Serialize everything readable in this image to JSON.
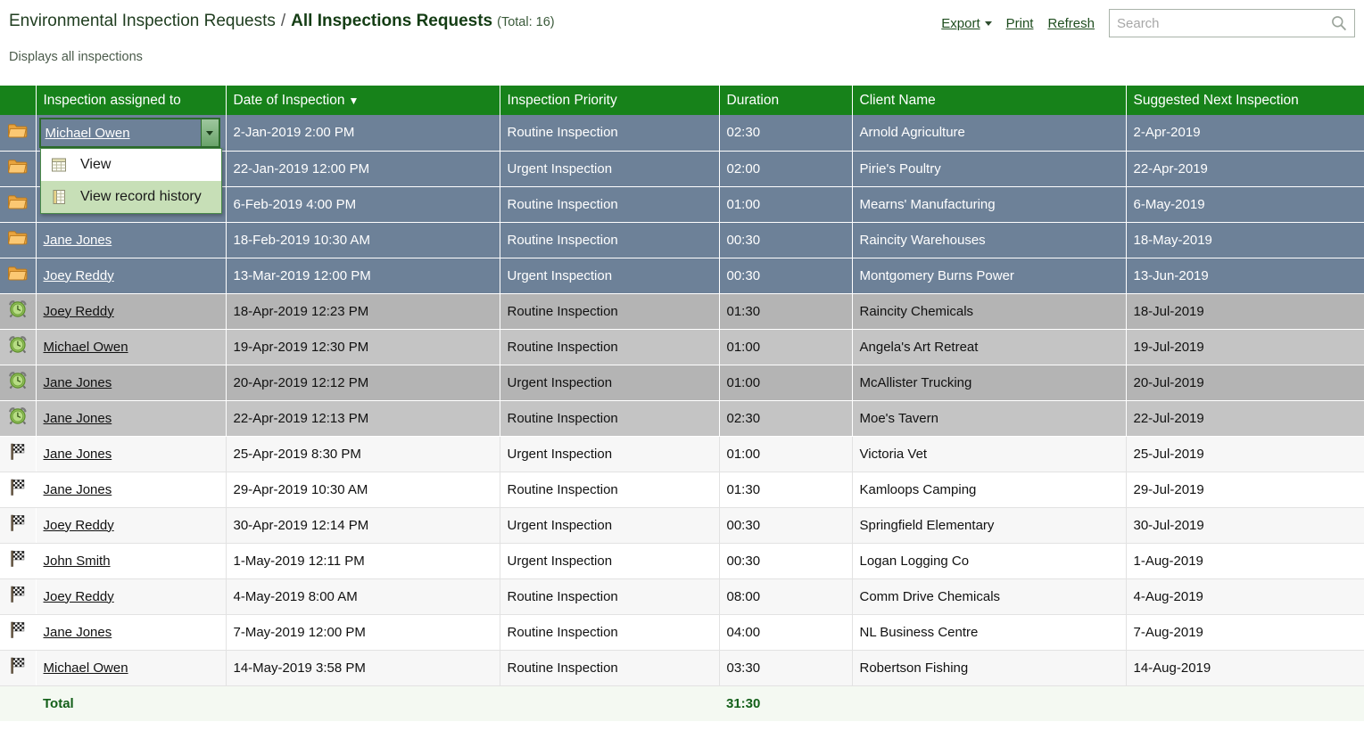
{
  "breadcrumb": {
    "parent": "Environmental Inspection Requests",
    "separator": "/",
    "current": "All Inspections Requests",
    "total": "(Total: 16)"
  },
  "subtitle": "Displays all inspections",
  "toolbar": {
    "export_label": "Export",
    "print_label": "Print",
    "refresh_label": "Refresh"
  },
  "search": {
    "placeholder": "Search",
    "value": "",
    "icon": "search-icon"
  },
  "colors": {
    "header_green": "#17821a",
    "selected_row": "#6d8198",
    "highlight_green": "#c7dfb7",
    "total_text": "#14601a"
  },
  "table": {
    "columns": [
      {
        "label": "",
        "key": "icon"
      },
      {
        "label": "Inspection assigned to",
        "key": "assigned"
      },
      {
        "label": "Date of Inspection",
        "key": "date",
        "sort": "▼"
      },
      {
        "label": "Inspection Priority",
        "key": "priority"
      },
      {
        "label": "Duration",
        "key": "duration"
      },
      {
        "label": "Client Name",
        "key": "client"
      },
      {
        "label": "Suggested Next Inspection",
        "key": "next"
      }
    ],
    "rows": [
      {
        "icon": "folder-icon",
        "state": "sel",
        "editor": true,
        "assigned": "Michael Owen",
        "date": "2-Jan-2019 2:00 PM",
        "priority": "Routine Inspection",
        "duration": "02:30",
        "client": "Arnold Agriculture",
        "next": "2-Apr-2019"
      },
      {
        "icon": "folder-icon",
        "state": "sel",
        "assigned": "",
        "date": "22-Jan-2019 12:00 PM",
        "priority": "Urgent Inspection",
        "duration": "02:00",
        "client": "Pirie's Poultry",
        "next": "22-Apr-2019"
      },
      {
        "icon": "folder-icon",
        "state": "sel",
        "assigned": "",
        "date": "6-Feb-2019 4:00 PM",
        "priority": "Routine Inspection",
        "duration": "01:00",
        "client": "Mearns' Manufacturing",
        "next": "6-May-2019"
      },
      {
        "icon": "folder-icon",
        "state": "sel",
        "assigned": "Jane Jones",
        "date": "18-Feb-2019 10:30 AM",
        "priority": "Routine Inspection",
        "duration": "00:30",
        "client": "Raincity Warehouses",
        "next": "18-May-2019"
      },
      {
        "icon": "folder-icon",
        "state": "sel",
        "assigned": "Joey Reddy",
        "date": "13-Mar-2019 12:00 PM",
        "priority": "Urgent Inspection",
        "duration": "00:30",
        "client": "Montgomery Burns Power",
        "next": "13-Jun-2019"
      },
      {
        "icon": "alarm-clock-icon",
        "state": "gray-a",
        "assigned": "Joey Reddy",
        "date": "18-Apr-2019 12:23 PM",
        "priority": "Routine Inspection",
        "duration": "01:30",
        "client": "Raincity Chemicals",
        "next": "18-Jul-2019"
      },
      {
        "icon": "alarm-clock-icon",
        "state": "gray-b",
        "assigned": "Michael Owen",
        "date": "19-Apr-2019 12:30 PM",
        "priority": "Routine Inspection",
        "duration": "01:00",
        "client": "Angela's Art Retreat",
        "next": "19-Jul-2019"
      },
      {
        "icon": "alarm-clock-icon",
        "state": "gray-a",
        "assigned": "Jane Jones",
        "date": "20-Apr-2019 12:12 PM",
        "priority": "Urgent Inspection",
        "duration": "01:00",
        "client": "McAllister Trucking",
        "next": "20-Jul-2019"
      },
      {
        "icon": "alarm-clock-icon",
        "state": "gray-b",
        "assigned": "Jane Jones",
        "date": "22-Apr-2019 12:13 PM",
        "priority": "Routine Inspection",
        "duration": "02:30",
        "client": "Moe's Tavern",
        "next": "22-Jul-2019"
      },
      {
        "icon": "checkered-flag-icon",
        "state": "light-a",
        "assigned": "Jane Jones",
        "date": "25-Apr-2019 8:30 PM",
        "priority": "Urgent Inspection",
        "duration": "01:00",
        "client": "Victoria Vet",
        "next": "25-Jul-2019"
      },
      {
        "icon": "checkered-flag-icon",
        "state": "light-b",
        "assigned": "Jane Jones",
        "date": "29-Apr-2019 10:30 AM",
        "priority": "Routine Inspection",
        "duration": "01:30",
        "client": "Kamloops Camping",
        "next": "29-Jul-2019"
      },
      {
        "icon": "checkered-flag-icon",
        "state": "light-a",
        "assigned": "Joey Reddy",
        "date": "30-Apr-2019 12:14 PM",
        "priority": "Urgent Inspection",
        "duration": "00:30",
        "client": "Springfield Elementary",
        "next": "30-Jul-2019"
      },
      {
        "icon": "checkered-flag-icon",
        "state": "light-b",
        "assigned": "John Smith",
        "date": "1-May-2019 12:11 PM",
        "priority": "Urgent Inspection",
        "duration": "00:30",
        "client": "Logan Logging Co",
        "next": "1-Aug-2019"
      },
      {
        "icon": "checkered-flag-icon",
        "state": "light-a",
        "assigned": "Joey Reddy",
        "date": "4-May-2019 8:00 AM",
        "priority": "Routine Inspection",
        "duration": "08:00",
        "client": "Comm Drive Chemicals",
        "next": "4-Aug-2019"
      },
      {
        "icon": "checkered-flag-icon",
        "state": "light-b",
        "assigned": "Jane Jones",
        "date": "7-May-2019 12:00 PM",
        "priority": "Routine Inspection",
        "duration": "04:00",
        "client": "NL Business Centre",
        "next": "7-Aug-2019"
      },
      {
        "icon": "checkered-flag-icon",
        "state": "light-a",
        "assigned": "Michael Owen",
        "date": "14-May-2019 3:58 PM",
        "priority": "Routine Inspection",
        "duration": "03:30",
        "client": "Robertson Fishing",
        "next": "14-Aug-2019"
      }
    ],
    "footer": {
      "label": "Total",
      "duration_total": "31:30"
    }
  },
  "editor": {
    "value": "Michael Owen",
    "dropdown_icon": "chevron-down-icon"
  },
  "context_menu": {
    "items": [
      {
        "label": "View",
        "icon": "grid-view-icon",
        "highlighted": false
      },
      {
        "label": "View record history",
        "icon": "history-record-icon",
        "highlighted": true
      }
    ]
  }
}
